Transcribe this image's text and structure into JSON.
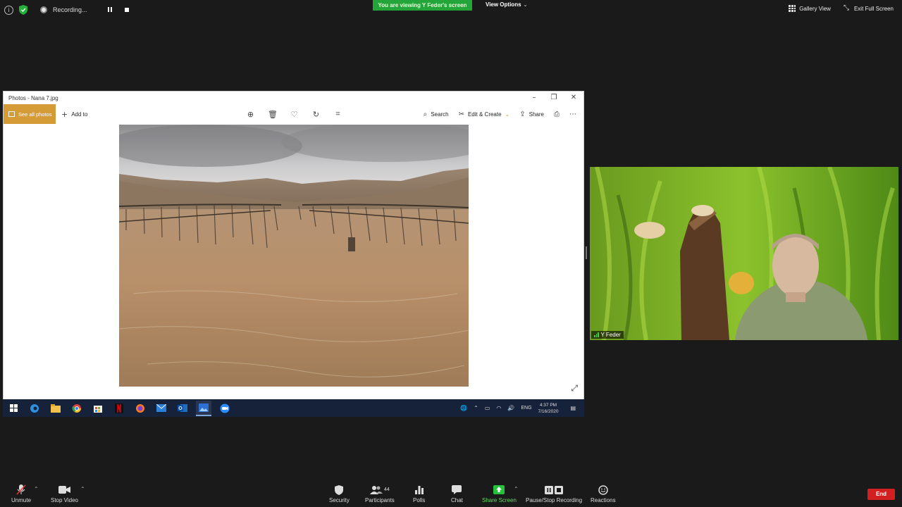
{
  "top_bar": {
    "recording_label": "Recording...",
    "viewing_banner": "You are viewing Y Feder's screen",
    "view_options": "View Options",
    "gallery_view": "Gallery View",
    "exit_full_screen": "Exit Full Screen"
  },
  "photos": {
    "window_title": "Photos - Nana 7.jpg",
    "see_all_photos": "See all photos",
    "add_to": "Add to",
    "search": "Search",
    "edit_create": "Edit & Create",
    "share": "Share"
  },
  "taskbar": {
    "language": "ENG",
    "time": "4:37 PM",
    "date": "7/16/2020"
  },
  "video": {
    "participant_name": "Y Feder"
  },
  "bottom_bar": {
    "unmute": "Unmute",
    "stop_video": "Stop Video",
    "security": "Security",
    "participants": "Participants",
    "participants_count": "44",
    "polls": "Polls",
    "chat": "Chat",
    "share_screen": "Share Screen",
    "pause_stop_recording": "Pause/Stop Recording",
    "reactions": "Reactions",
    "end": "End"
  },
  "colors": {
    "banner_green": "#23a53a",
    "share_green": "#5be05b",
    "end_red": "#d1201f",
    "photos_accent": "#d49b37"
  }
}
